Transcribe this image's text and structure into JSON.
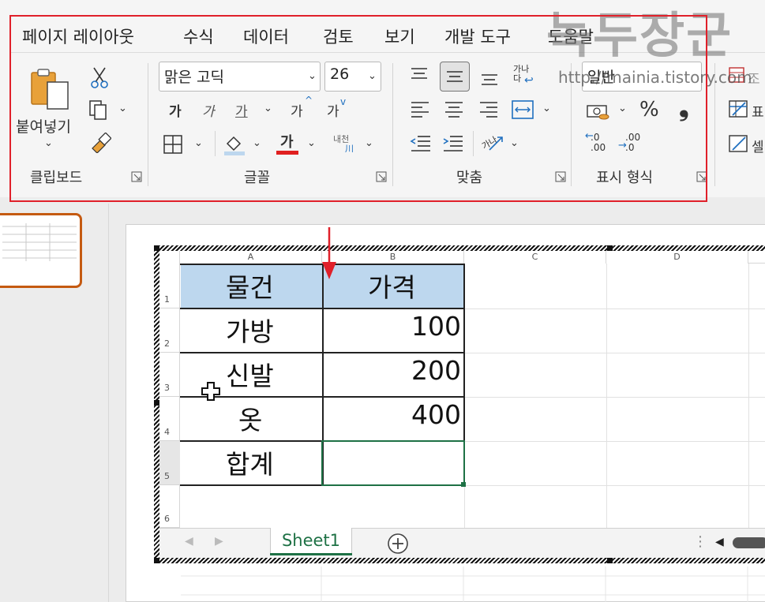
{
  "menu": {
    "tabs": [
      "페이지 레이아웃",
      "수식",
      "데이터",
      "검토",
      "보기",
      "개발 도구",
      "도움말"
    ]
  },
  "watermark": {
    "logo_text": "녹두장군",
    "url": "http://mainia.tistory.com"
  },
  "clipboard": {
    "paste_label": "붙여넣기",
    "group_label": "클립보드"
  },
  "font": {
    "name": "맑은 고딕",
    "size": "26",
    "bold": "가",
    "italic": "가",
    "underline": "가",
    "grow": "가",
    "shrink": "가",
    "font_color_glyph": "가",
    "phonetic": "내천",
    "group_label": "글꼴"
  },
  "alignment": {
    "wrap_glyph": "가나\n다",
    "group_label": "맞춤"
  },
  "number": {
    "format": "일반",
    "percent": "%",
    "comma": "❟",
    "inc_decimal": ".0\n.00",
    "dec_decimal": ".00\n.0",
    "group_label": "표시 형식"
  },
  "right_cut": {
    "a": "조",
    "b": "표",
    "c": "셀"
  },
  "sheet": {
    "columns": [
      "A",
      "B",
      "C",
      "D"
    ],
    "rows": [
      "1",
      "2",
      "3",
      "4",
      "5",
      "6"
    ],
    "table": {
      "header": [
        "물건",
        "가격"
      ],
      "rows": [
        [
          "가방",
          "100"
        ],
        [
          "신발",
          "200"
        ],
        [
          "옷",
          "400"
        ],
        [
          "합계",
          ""
        ]
      ]
    },
    "tab_name": "Sheet1"
  },
  "colors": {
    "highlight_red": "#e0202a",
    "header_fill": "#bdd7ee",
    "excel_green": "#1e7145",
    "thumb_orange": "#c55a11"
  }
}
